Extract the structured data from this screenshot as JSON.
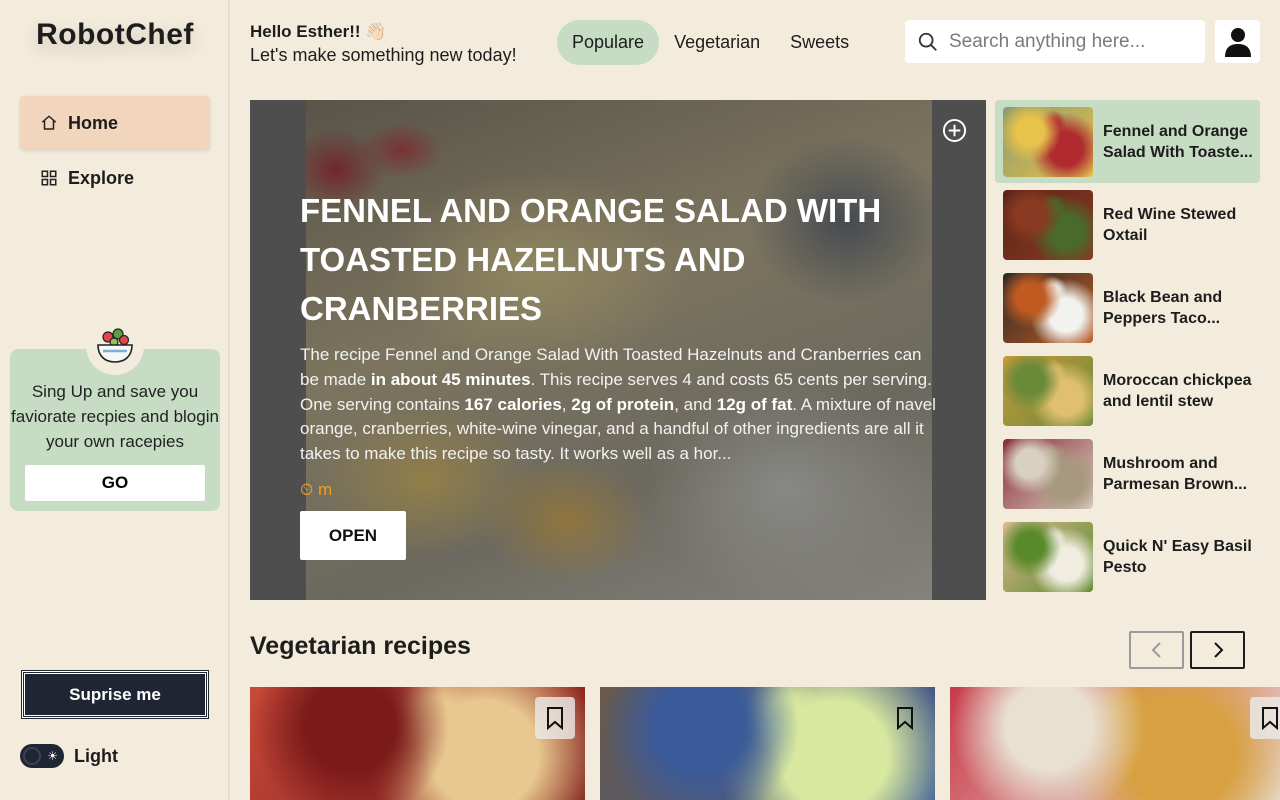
{
  "app": {
    "name": "RobotChef"
  },
  "sidebar": {
    "nav": [
      {
        "label": "Home",
        "icon": "home-icon",
        "active": true
      },
      {
        "label": "Explore",
        "icon": "grid-icon",
        "active": false
      }
    ],
    "promo": {
      "icon": "salad-bowl-icon",
      "text": "Sing Up and save you faviorate recpies and blogin your own racepies",
      "button": "GO"
    },
    "surprise_button": "Suprise me",
    "theme_label": "Light"
  },
  "header": {
    "greeting": "Hello Esther!! 👋🏻",
    "subtitle": "Let's make something new today!",
    "tabs": [
      {
        "label": "Populare",
        "active": true
      },
      {
        "label": "Vegetarian",
        "active": false
      },
      {
        "label": "Sweets",
        "active": false
      }
    ],
    "search_placeholder": "Search anything here..."
  },
  "hero": {
    "title": "Fennel and Orange Salad With Toasted Hazelnuts and Cranberries",
    "description_parts": [
      "The recipe Fennel and Orange Salad With Toasted Hazelnuts and Cranberries can be made ",
      "in about 45 minutes",
      ". This recipe serves 4 and costs 65 cents per serving. One serving contains ",
      "167 calories",
      ", ",
      "2g of protein",
      ", and ",
      "12g of fat",
      ". A mixture of navel orange, cranberries, white-wine vinegar, and a handful of other ingredients are all it takes to make this recipe so tasty. It works well as a hor..."
    ],
    "time": "⏲ m",
    "open_button": "OPEN"
  },
  "side_recipes": [
    {
      "title": "Fennel and Orange Salad With Toaste...",
      "active": true,
      "colors": [
        "#8a9a70",
        "#e8c24a",
        "#b02a30"
      ]
    },
    {
      "title": "Red Wine Stewed Oxtail",
      "active": false,
      "colors": [
        "#5a2418",
        "#8a3a22",
        "#4a6a2a"
      ]
    },
    {
      "title": "Black Bean and Peppers Taco...",
      "active": false,
      "colors": [
        "#2a2a2a",
        "#c05a20",
        "#f2f2ee"
      ]
    },
    {
      "title": "Moroccan chickpea and lentil stew",
      "active": false,
      "colors": [
        "#c89a3a",
        "#6a8a3a",
        "#e0c070"
      ]
    },
    {
      "title": "Mushroom and Parmesan Brown...",
      "active": false,
      "colors": [
        "#8a2a3a",
        "#d8d0c0",
        "#a89880"
      ]
    },
    {
      "title": "Quick N' Easy Basil Pesto",
      "active": false,
      "colors": [
        "#d8b890",
        "#5a8a2a",
        "#f0ece0"
      ]
    }
  ],
  "vegetarian_section": {
    "title": "Vegetarian recipes",
    "cards": [
      {
        "name": "cherry-clafoutis",
        "colors": [
          "#c84a3a",
          "#7a1a1a",
          "#e8c890"
        ]
      },
      {
        "name": "fruit-melon-bowl",
        "colors": [
          "#6a5a4a",
          "#3a5a9a",
          "#d8e8a0"
        ]
      },
      {
        "name": "white-bean-soup",
        "colors": [
          "#c83a4a",
          "#e8e0d0",
          "#d8a040"
        ]
      }
    ]
  }
}
